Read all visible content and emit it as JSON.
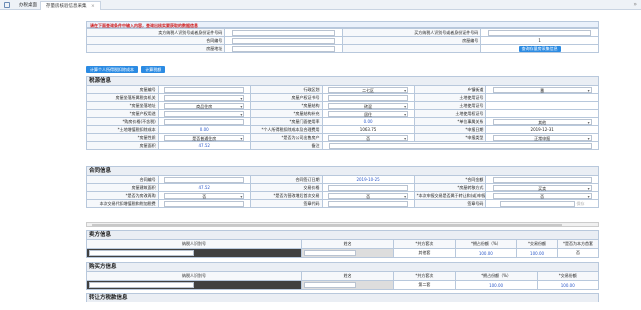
{
  "tabs": {
    "home": "办税桌面",
    "active": "存量房核验信息采集",
    "close": "×"
  },
  "notice": {
    "title": "请在下面查询条件中输入内容，查询出核实要获取的数据信息"
  },
  "query": {
    "seller_id_label": "卖方纳税人识别号或者身份证件号码",
    "buyer_id_label": "买方纳税人识别号或者身份证件号码",
    "contract_no_label": "合同编号",
    "house_no_label": "房屋编号",
    "house_no_value": "1",
    "address_label": "房屋地址",
    "query_btn": "查询存量房采集信息"
  },
  "actions": {
    "btn1": "计算个人所得税扣除成本",
    "btn2": "计算税额"
  },
  "tax": {
    "title": "税源信息",
    "rows": [
      [
        "房屋编号",
        "",
        "行政区划",
        "二七区",
        "乡镇街道",
        "",
        "番"
      ],
      [
        "房屋坐落所属税务机关",
        "",
        "房屋产权证书号",
        "",
        "土地使用证号",
        ""
      ],
      [
        "*房屋坐落地址",
        "商品住房",
        "*房屋结构",
        "砖混",
        "土地使用证号",
        ""
      ],
      [
        "*房屋产权用途",
        "",
        "*房屋结构补充",
        "居住",
        "土地使用权证号",
        ""
      ],
      [
        "*购房价格(不含税)",
        "",
        "*房屋门面使用率",
        "0.00",
        "*单位事属关系",
        "其他"
      ],
      [
        "*土地增值税扣除成本",
        "0.00",
        "*个人所得税扣除成本及合理费用",
        "1063.75",
        "*申报日期",
        "2019-12-31"
      ],
      [
        "*房屋性质",
        "是否普通住房",
        "*是否为公司出售房产",
        "否",
        "*申报类型",
        "正常申报"
      ],
      [
        "房屋面积",
        "47.52",
        "备注",
        ""
      ]
    ]
  },
  "contract": {
    "title": "合同信息",
    "rows": [
      [
        "合同编号",
        "",
        "合同签订日期",
        "2019-10-25",
        "*合同金额",
        ""
      ],
      [
        "房屋建筑面积",
        "47.52",
        "交易价格",
        "",
        "*房屋转移方式",
        "买卖"
      ],
      [
        "*是否为房改再购",
        "否",
        "*是否为营改增后首次交易",
        "否",
        "*本次申报交易是否属于转让和(或)申报",
        "否"
      ],
      [
        "本次交易代扣增值税和附加税费",
        "",
        "签章代码",
        "",
        "签章号码",
        ""
      ]
    ],
    "save_btn": "保存"
  },
  "seller": {
    "title": "卖方信息",
    "headers": [
      "纳税人识别号",
      "姓名",
      "*共方套次",
      "*拥占份额（%）",
      "*交易份额",
      "*是否为本方首套"
    ],
    "row": [
      "",
      "",
      "其他套",
      "100.00",
      "100.00",
      "否"
    ]
  },
  "buyer": {
    "title": "购买方信息",
    "headers": [
      "纳税人识别号",
      "姓名",
      "*共方套次",
      "*拥占份额（%）",
      "*交易份额"
    ],
    "row": [
      "",
      "",
      "第二套",
      "100.00",
      "100.00"
    ]
  },
  "transfer": {
    "title": "转让方税款信息"
  },
  "colors": {
    "accent": "#2b8be3",
    "notice": "#d12020",
    "border": "#b8c8dc"
  }
}
